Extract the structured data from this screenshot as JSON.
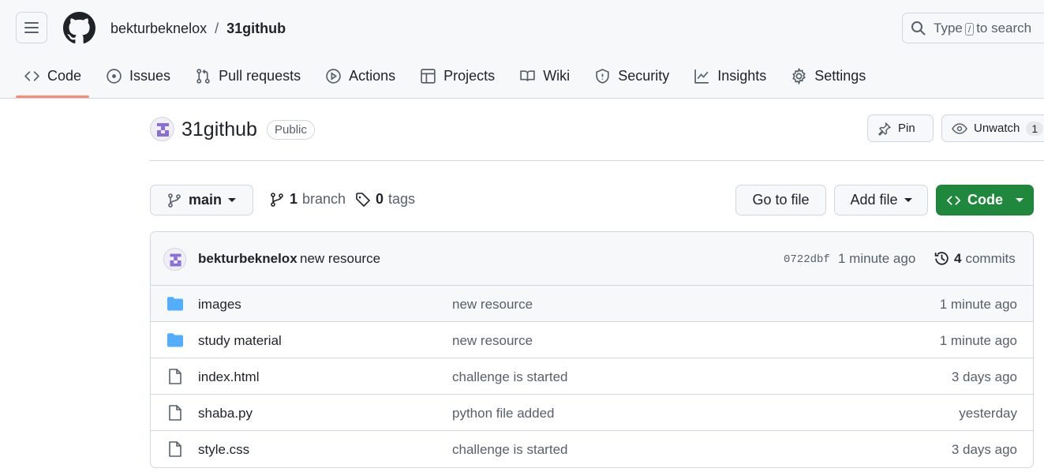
{
  "header": {
    "owner": "bekturbeknelox",
    "separator": "/",
    "repo": "31github",
    "search": {
      "before": "Type",
      "key": "/",
      "after": "to search"
    }
  },
  "tabs": [
    {
      "label": "Code",
      "icon": "code-icon",
      "active": true
    },
    {
      "label": "Issues",
      "icon": "issue-icon"
    },
    {
      "label": "Pull requests",
      "icon": "pull-request-icon"
    },
    {
      "label": "Actions",
      "icon": "play-icon"
    },
    {
      "label": "Projects",
      "icon": "table-icon"
    },
    {
      "label": "Wiki",
      "icon": "book-icon"
    },
    {
      "label": "Security",
      "icon": "shield-icon"
    },
    {
      "label": "Insights",
      "icon": "graph-icon"
    },
    {
      "label": "Settings",
      "icon": "gear-icon"
    }
  ],
  "repo": {
    "title": "31github",
    "visibility": "Public",
    "pin_label": "Pin",
    "watch_label": "Unwatch",
    "watch_count": "1"
  },
  "branch": {
    "current": "main",
    "branch_count": "1",
    "branch_word": "branch",
    "tag_count": "0",
    "tag_word": "tags",
    "goto_label": "Go to file",
    "add_label": "Add file",
    "code_label": "Code"
  },
  "commit": {
    "author": "bekturbeknelox",
    "message": "new resource",
    "sha": "0722dbf",
    "time": "1 minute ago",
    "count": "4",
    "count_word": "commits"
  },
  "files": [
    {
      "type": "folder",
      "name": "images",
      "message": "new resource",
      "time": "1 minute ago"
    },
    {
      "type": "folder",
      "name": "study material",
      "message": "new resource",
      "time": "1 minute ago"
    },
    {
      "type": "file",
      "name": "index.html",
      "message": "challenge is started",
      "time": "3 days ago"
    },
    {
      "type": "file",
      "name": "shaba.py",
      "message": "python file added",
      "time": "yesterday"
    },
    {
      "type": "file",
      "name": "style.css",
      "message": "challenge is started",
      "time": "3 days ago"
    }
  ],
  "colors": {
    "accent_underline": "#fd8c73",
    "code_button": "#1f883d",
    "folder": "#54aeff"
  }
}
